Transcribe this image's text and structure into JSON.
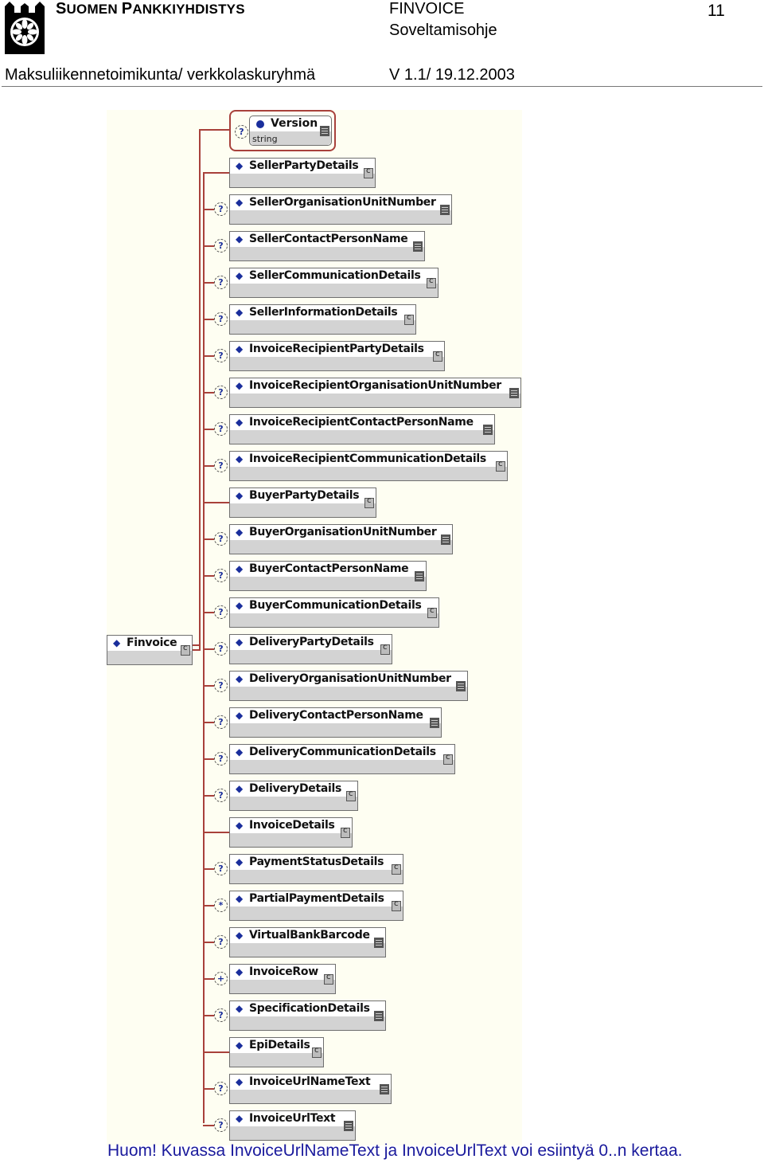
{
  "header": {
    "org_name_first_initial": "S",
    "org_name_first_rest": "UOMEN",
    "org_name_second_initial": "P",
    "org_name_second_rest": "ANKKIYHDISTYS",
    "doc_title": "FINVOICE",
    "doc_subtitle": "Soveltamisohje",
    "page_number": "11",
    "department": "Maksuliikennetoimikunta/ verkkolaskuryhmä",
    "version": "V 1.1/ 19.12.2003",
    "logo_icon": "bank-association-logo-icon"
  },
  "diagram": {
    "root": {
      "label": "Finvoice",
      "type": "complex"
    },
    "attribute": {
      "label": "Version",
      "datatype": "string",
      "occurrence": "optional",
      "type": "simple"
    },
    "elements": [
      {
        "label": "SellerPartyDetails",
        "occurrence": "required",
        "type": "complex"
      },
      {
        "label": "SellerOrganisationUnitNumber",
        "occurrence": "optional",
        "type": "simple"
      },
      {
        "label": "SellerContactPersonName",
        "occurrence": "optional",
        "type": "simple"
      },
      {
        "label": "SellerCommunicationDetails",
        "occurrence": "optional",
        "type": "complex"
      },
      {
        "label": "SellerInformationDetails",
        "occurrence": "optional",
        "type": "complex"
      },
      {
        "label": "InvoiceRecipientPartyDetails",
        "occurrence": "optional",
        "type": "complex"
      },
      {
        "label": "InvoiceRecipientOrganisationUnitNumber",
        "occurrence": "optional",
        "type": "simple"
      },
      {
        "label": "InvoiceRecipientContactPersonName",
        "occurrence": "optional",
        "type": "simple"
      },
      {
        "label": "InvoiceRecipientCommunicationDetails",
        "occurrence": "optional",
        "type": "complex"
      },
      {
        "label": "BuyerPartyDetails",
        "occurrence": "required",
        "type": "complex"
      },
      {
        "label": "BuyerOrganisationUnitNumber",
        "occurrence": "optional",
        "type": "simple"
      },
      {
        "label": "BuyerContactPersonName",
        "occurrence": "optional",
        "type": "simple"
      },
      {
        "label": "BuyerCommunicationDetails",
        "occurrence": "optional",
        "type": "complex"
      },
      {
        "label": "DeliveryPartyDetails",
        "occurrence": "optional",
        "type": "complex"
      },
      {
        "label": "DeliveryOrganisationUnitNumber",
        "occurrence": "optional",
        "type": "simple"
      },
      {
        "label": "DeliveryContactPersonName",
        "occurrence": "optional",
        "type": "simple"
      },
      {
        "label": "DeliveryCommunicationDetails",
        "occurrence": "optional",
        "type": "complex"
      },
      {
        "label": "DeliveryDetails",
        "occurrence": "optional",
        "type": "complex"
      },
      {
        "label": "InvoiceDetails",
        "occurrence": "required",
        "type": "complex"
      },
      {
        "label": "PaymentStatusDetails",
        "occurrence": "optional",
        "type": "complex"
      },
      {
        "label": "PartialPaymentDetails",
        "occurrence": "zero-or-more",
        "type": "complex"
      },
      {
        "label": "VirtualBankBarcode",
        "occurrence": "optional",
        "type": "simple"
      },
      {
        "label": "InvoiceRow",
        "occurrence": "one-or-more",
        "type": "complex"
      },
      {
        "label": "SpecificationDetails",
        "occurrence": "optional",
        "type": "simple"
      },
      {
        "label": "EpiDetails",
        "occurrence": "required",
        "type": "complex"
      },
      {
        "label": "InvoiceUrlNameText",
        "occurrence": "optional",
        "type": "simple"
      },
      {
        "label": "InvoiceUrlText",
        "occurrence": "optional",
        "type": "simple"
      }
    ],
    "occurrence_symbols": {
      "optional": "?",
      "zero-or-more": "*",
      "one-or-more": "+",
      "required": ""
    },
    "colors": {
      "connector": "#a8413b",
      "bullet": "#1a2e9c",
      "background": "#fefef2",
      "node_footer": "#d3d3d3"
    }
  },
  "caption": "Huom! Kuvassa InvoiceUrlNameText ja InvoiceUrlText voi esiintyä 0..n kertaa."
}
